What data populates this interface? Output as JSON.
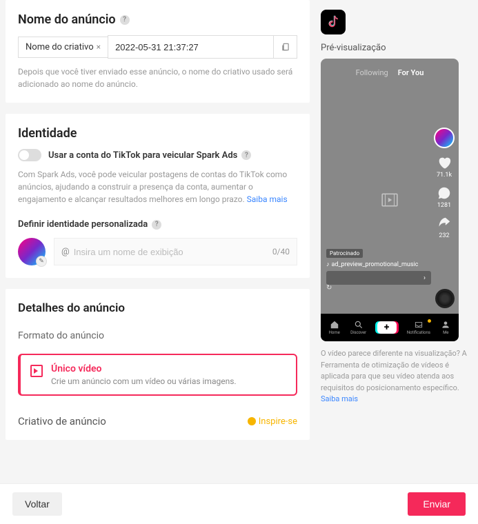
{
  "nameSection": {
    "title": "Nome do anúncio",
    "tagLabel": "Nome do criativo",
    "value": "2022-05-31 21:37:27",
    "helper": "Depois que você tiver enviado esse anúncio, o nome do criativo usado será adicionado ao nome do anúncio."
  },
  "identity": {
    "title": "Identidade",
    "sparkLabel": "Usar a conta do TikTok para veicular Spark Ads",
    "sparkHelp": "Com Spark Ads, você pode veicular postagens de contas do TikTok como anúncios, ajudando a construir a presença da conta, aumentar o engajamento e alcançar resultados melhores em longo prazo. ",
    "sparkLearn": "Saiba mais",
    "customLabel": "Definir identidade personalizada",
    "at": "@",
    "placeholder": "Insira um nome de exibição",
    "count": "0/40"
  },
  "details": {
    "title": "Detalhes do anúncio",
    "formatLabel": "Formato do anúncio",
    "singleVideoTitle": "Único vídeo",
    "singleVideoDesc": "Crie um anúncio com um vídeo ou várias imagens.",
    "creativeLabel": "Criativo de anúncio",
    "inspire": "Inspire-se"
  },
  "preview": {
    "label": "Pré-visualização",
    "following": "Following",
    "forYou": "For You",
    "likes": "71.1k",
    "comments": "1281",
    "shares": "232",
    "sponsored": "Patrocinado",
    "music": "ad_preview_promotional_music",
    "nav": {
      "home": "Home",
      "discover": "Discover",
      "notifications": "Notifications",
      "me": "Me"
    },
    "helpText": "O vídeo parece diferente na visualização? A Ferramenta de otimização de vídeos é aplicada para que seu vídeo atenda aos requisitos do posicionamento específico. ",
    "learnMore": "Saiba mais"
  },
  "footer": {
    "back": "Voltar",
    "submit": "Enviar"
  }
}
